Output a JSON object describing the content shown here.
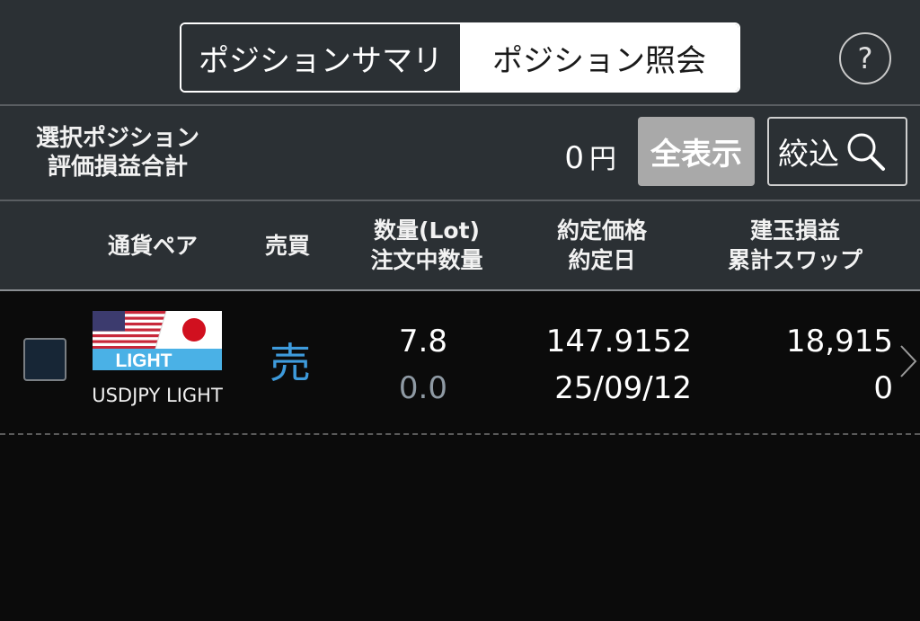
{
  "header": {
    "tabs": [
      {
        "label": "ポジションサマリ",
        "selected": false
      },
      {
        "label": "ポジション照会",
        "selected": true
      }
    ],
    "help_icon": "question-circle-icon"
  },
  "summary": {
    "label_line1": "選択ポジション",
    "label_line2": "評価損益合計",
    "value": "0",
    "unit": "円",
    "show_all_label": "全表示",
    "filter_label": "絞込",
    "filter_icon": "search-icon"
  },
  "columns": {
    "pair": "通貨ペア",
    "side": "売買",
    "qty_line1": "数量(Lot)",
    "qty_line2": "注文中数量",
    "price_line1": "約定価格",
    "price_line2": "約定日",
    "pnl_line1": "建玉損益",
    "pnl_line2": "累計スワップ"
  },
  "positions": [
    {
      "checked": false,
      "flag_badge": "LIGHT",
      "pair_name": "USDJPY LIGHT",
      "side": "売",
      "quantity": "7.8",
      "pending_quantity": "0.0",
      "price": "147.9152",
      "date": "25/09/12",
      "pnl": "18,915",
      "swap": "0"
    }
  ],
  "colors": {
    "header_bg": "#2b3034",
    "body_bg": "#0b0b0b",
    "sell_color": "#3e9bdc",
    "muted_value": "#8f9aa4",
    "show_all_bg": "#a9a9a9",
    "badge_bg": "#4ab1e6"
  }
}
